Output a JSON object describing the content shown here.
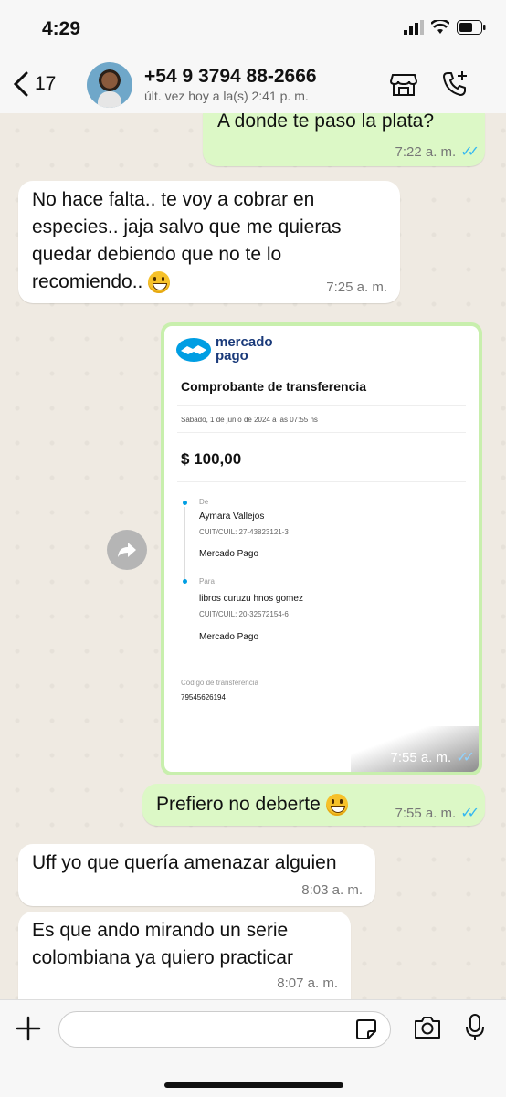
{
  "status_bar": {
    "time": "4:29"
  },
  "header": {
    "back_count": "17",
    "contact_name": "+54 9 3794 88-2666",
    "contact_status": "últ. vez hoy a la(s) 2:41 p. m."
  },
  "messages": [
    {
      "direction": "out",
      "text": "A donde te paso la plata?",
      "time": "7:22 a. m."
    },
    {
      "direction": "in",
      "text": "No hace falta.. te voy a cobrar en especies.. jaja salvo que me quieras quedar debiendo que no te lo recomiendo..",
      "time": "7:25 a. m."
    },
    {
      "direction": "out",
      "type": "image",
      "time": "7:55 a. m."
    },
    {
      "direction": "out",
      "text": "Prefiero no deberte",
      "time": "7:55 a. m."
    },
    {
      "direction": "in",
      "text": "Uff yo que quería amenazar alguien",
      "time": "8:03 a. m."
    },
    {
      "direction": "in",
      "text": "Es que ando mirando un serie colombiana ya quiero practicar",
      "time": "8:07 a. m."
    }
  ],
  "receipt": {
    "brand_line1": "mercado",
    "brand_line2": "pago",
    "title": "Comprobante de transferencia",
    "date": "Sábado, 1 de junio de 2024 a las 07:55 hs",
    "amount": "$ 100,00",
    "from_label": "De",
    "from_name": "Aymara Vallejos",
    "from_cuit": "CUIT/CUIL: 27-43823121-3",
    "from_bank": "Mercado Pago",
    "to_label": "Para",
    "to_name": "libros curuzu hnos gomez",
    "to_cuit": "CUIT/CUIL: 20-32572154-6",
    "to_bank": "Mercado Pago",
    "code_label": "Código de transferencia",
    "code_value": "79545626194"
  },
  "colors": {
    "outgoing": "#dcf8c6",
    "incoming": "#ffffff",
    "read_ticks": "#34b7f1",
    "mp_blue": "#009ee3"
  }
}
